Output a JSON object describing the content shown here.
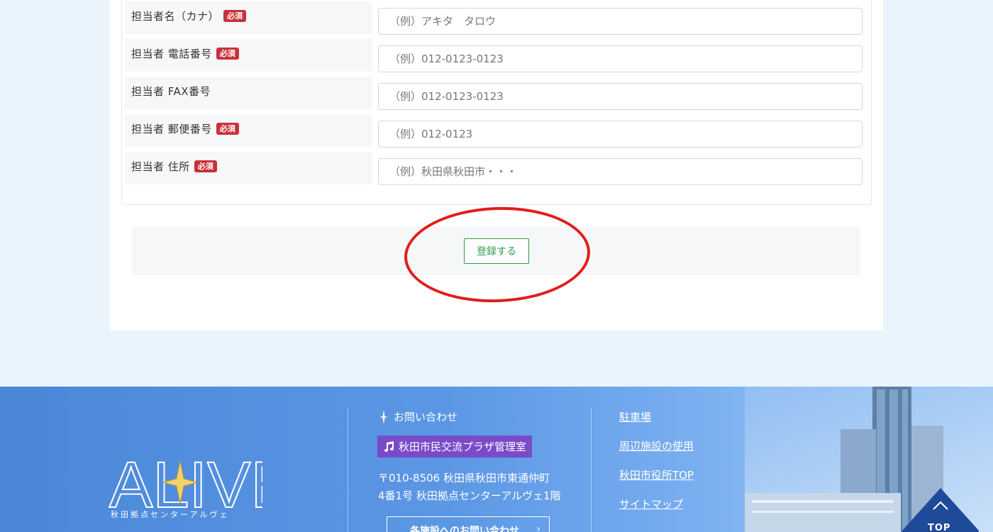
{
  "badge_required": "必須",
  "form": {
    "rows": [
      {
        "label": "担当者名（カナ）",
        "required": true,
        "placeholder": "（例）アキタ　タロウ"
      },
      {
        "label": "担当者 電話番号",
        "required": true,
        "placeholder": "（例）012-0123-0123"
      },
      {
        "label": "担当者 FAX番号",
        "required": false,
        "placeholder": "（例）012-0123-0123"
      },
      {
        "label": "担当者 郵便番号",
        "required": true,
        "placeholder": "（例）012-0123"
      },
      {
        "label": "担当者 住所",
        "required": true,
        "placeholder": "（例）秋田県秋田市・・・"
      }
    ],
    "submit_label": "登録する"
  },
  "footer": {
    "logo_text": "ALIVE",
    "logo_caption": "秋田拠点センターアルヴェ",
    "contact_heading": "お問い合わせ",
    "office_name": "秋田市民交流プラザ管理室",
    "address_line1": "〒010-8506 秋田県秋田市東通仲町",
    "address_line2": "4番1号 秋田拠点センターアルヴェ1階",
    "contact_button": "各施設へのお問い合わせ",
    "links": [
      "駐車場",
      "周辺施設の使用",
      "秋田市役所TOP",
      "サイトマップ"
    ],
    "top_label": "TOP"
  },
  "colors": {
    "required_badge": "#c9303a",
    "submit_border": "#2e9a49",
    "annotation_ring": "#e31c1c",
    "footer_blue": "#4b87d8",
    "office_badge": "#7a4bc8"
  }
}
